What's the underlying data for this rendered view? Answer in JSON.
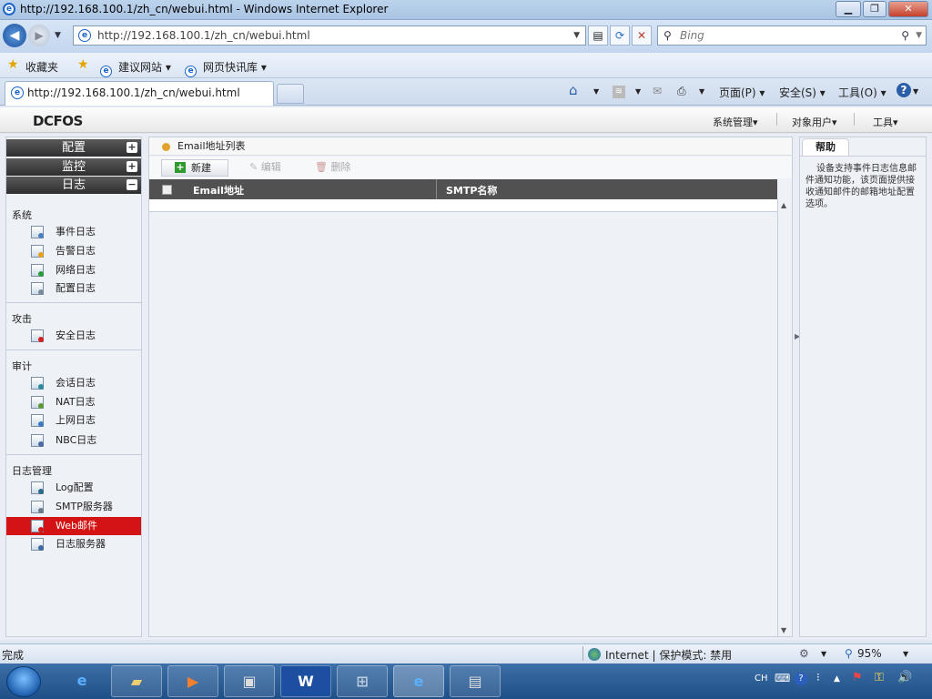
{
  "browser": {
    "window_title": "http://192.168.100.1/zh_cn/webui.html - Windows Internet Explorer",
    "address": "http://192.168.100.1/zh_cn/webui.html",
    "search_placeholder": "Bing",
    "favorites_label": "收藏夹",
    "fav_links": [
      "建议网站 ▾",
      "网页快讯库 ▾"
    ],
    "tab_title": "http://192.168.100.1/zh_cn/webui.html",
    "commands": [
      "页面(P) ▾",
      "安全(S) ▾",
      "工具(O) ▾"
    ],
    "status_left": "完成",
    "status_zone": "Internet | 保护模式: 禁用",
    "zoom": "95%"
  },
  "app": {
    "logo": "DCFOS",
    "top_menu": [
      "系统管理▾",
      "对象用户▾",
      "工具▾"
    ],
    "sidebar": {
      "sections": [
        "配置",
        "监控",
        "日志"
      ],
      "groups": [
        "系统",
        "攻击",
        "审计",
        "日志管理"
      ],
      "items": [
        "事件日志",
        "告警日志",
        "网络日志",
        "配置日志",
        "安全日志",
        "会话日志",
        "NAT日志",
        "上网日志",
        "NBC日志",
        "Log配置",
        "SMTP服务器",
        "Web邮件",
        "日志服务器"
      ],
      "selected": "Web邮件"
    },
    "content": {
      "title": "Email地址列表",
      "toolbar": {
        "new": "新建",
        "edit": "编辑",
        "delete": "删除"
      },
      "columns": [
        "Email地址",
        "SMTP名称"
      ]
    },
    "help": {
      "tab": "帮助",
      "text": "设备支持事件日志信息邮件通知功能，该页面提供接收通知邮件的邮箱地址配置选项。"
    }
  },
  "taskbar": {
    "lang": "CH"
  }
}
